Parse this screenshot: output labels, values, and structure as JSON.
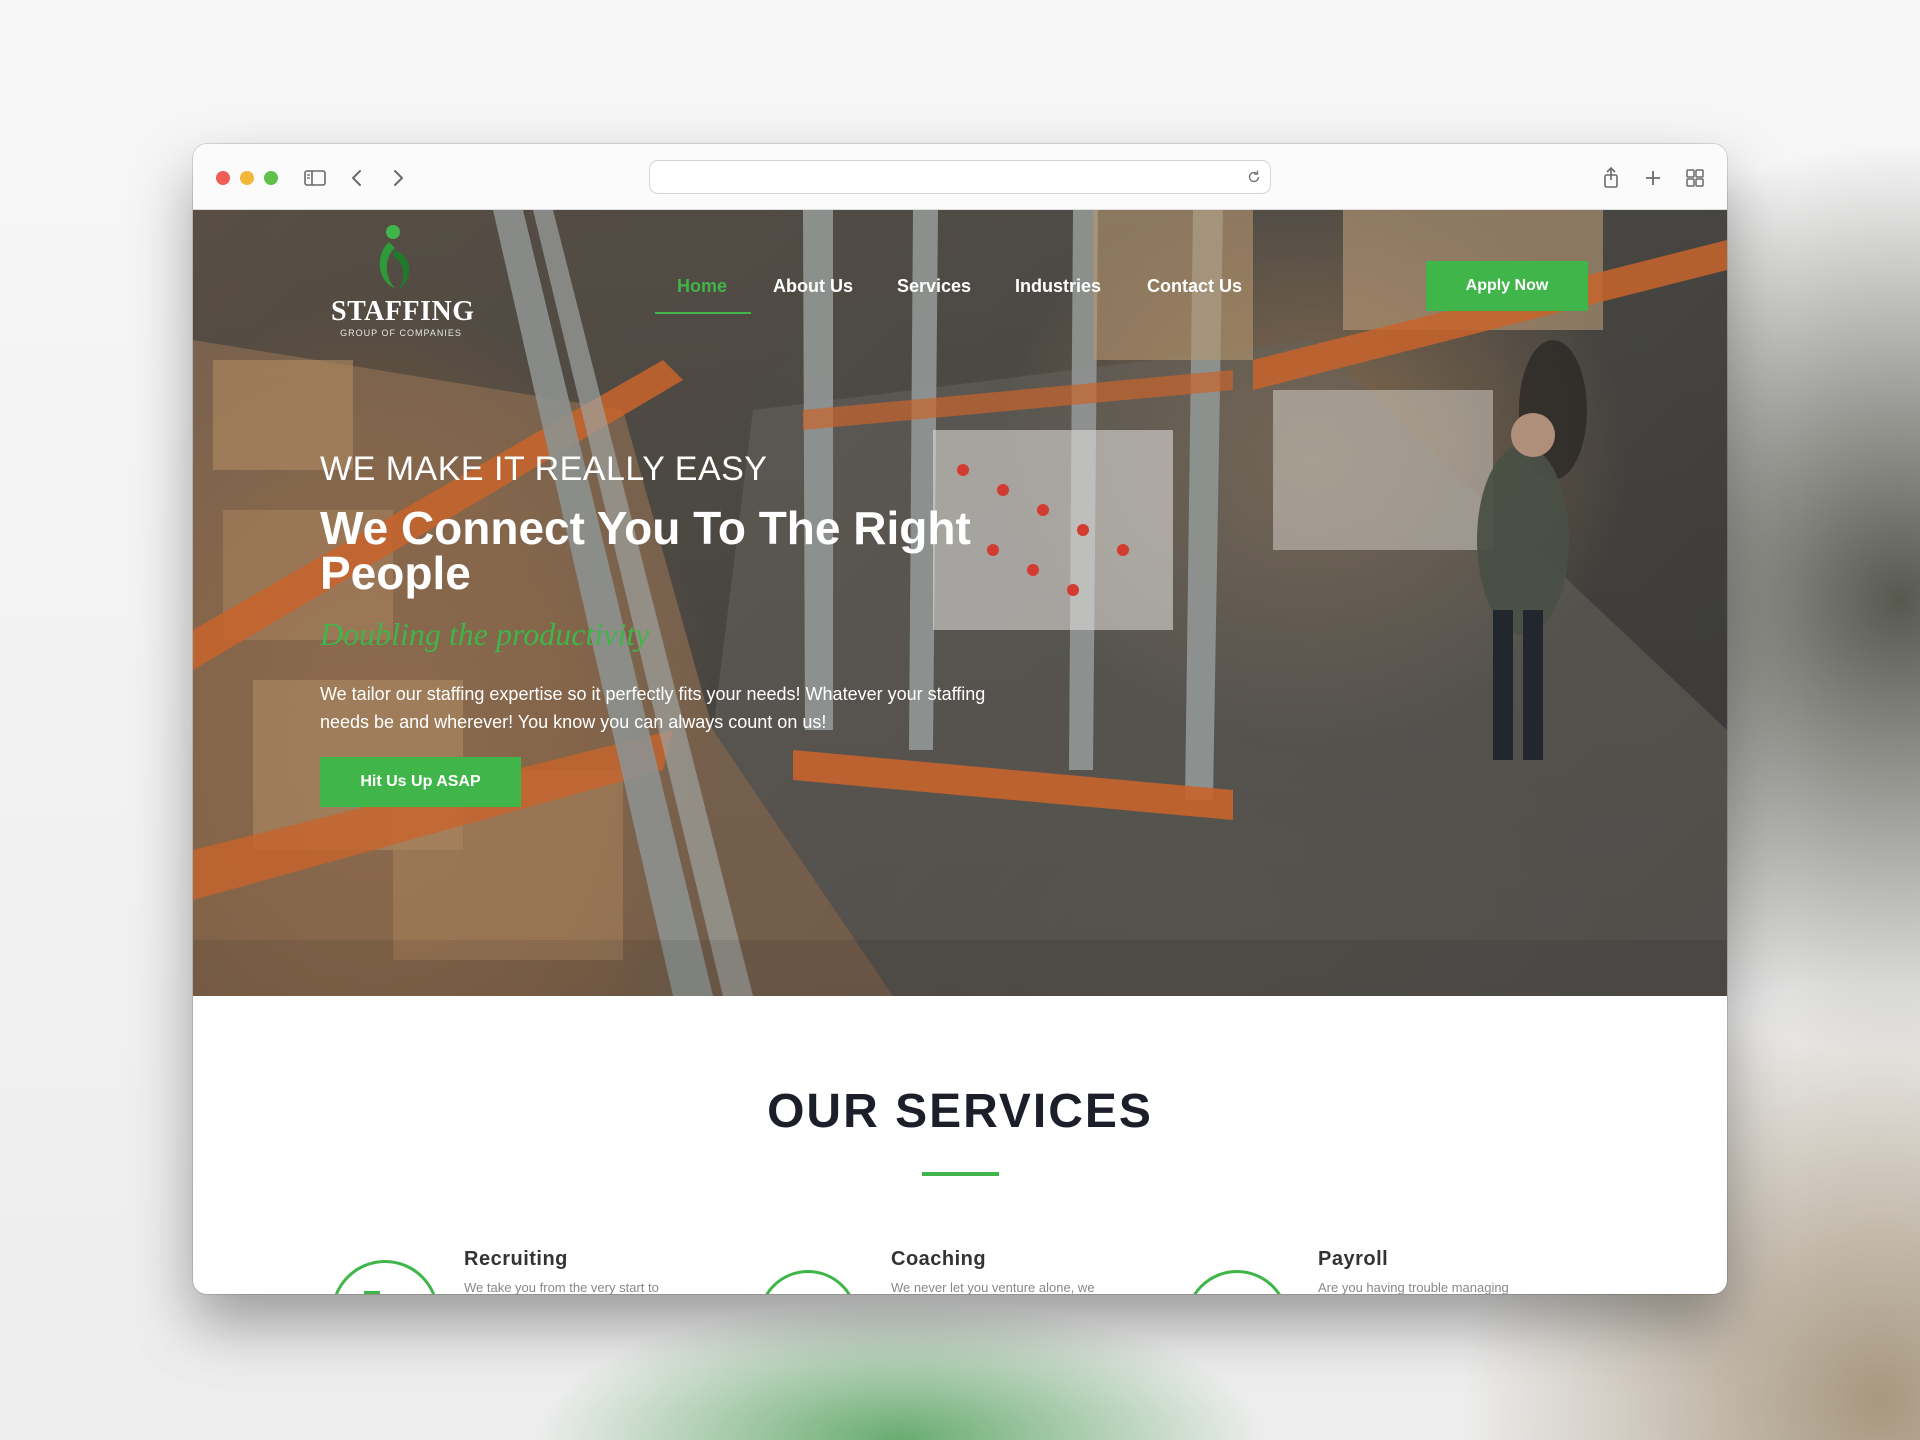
{
  "browser": {
    "address_text": "",
    "icons": [
      "sidebar-icon",
      "back-icon",
      "forward-icon",
      "reload-icon",
      "share-icon",
      "new-tab-icon",
      "tab-overview-icon"
    ]
  },
  "site": {
    "logo": {
      "word": "STAFFING",
      "sub": "GROUP OF COMPANIES"
    },
    "nav": {
      "items": [
        {
          "label": "Home",
          "active": true
        },
        {
          "label": "About Us",
          "active": false
        },
        {
          "label": "Services",
          "active": false
        },
        {
          "label": "Industries",
          "active": false
        },
        {
          "label": "Contact Us",
          "active": false
        }
      ]
    },
    "apply_label": "Apply Now",
    "hero": {
      "eyebrow": "WE MAKE IT REALLY EASY",
      "headline": "We Connect You To The Right People",
      "script": "Doubling the productivity",
      "description": "We tailor our staffing expertise so it perfectly fits your needs! Whatever your staffing needs be and wherever! You know you can always count on us!",
      "cta_label": "Hit Us Up ASAP"
    },
    "services": {
      "title": "OUR SERVICES",
      "items": [
        {
          "name": "Recruiting",
          "text": "We take you from the very start to"
        },
        {
          "name": "Coaching",
          "text": "We never let you venture alone, we"
        },
        {
          "name": "Payroll",
          "text": "Are you having trouble managing"
        }
      ]
    }
  },
  "colors": {
    "accent": "#3fb54a",
    "heading": "#1c1f2a"
  }
}
